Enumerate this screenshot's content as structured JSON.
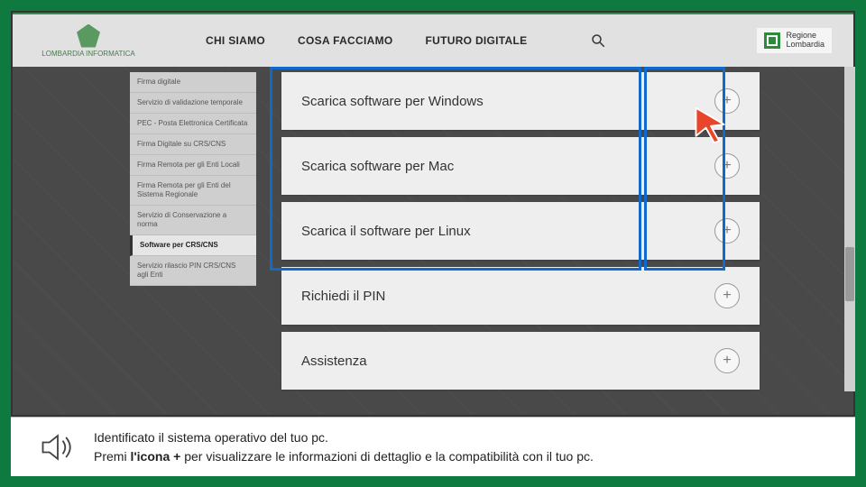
{
  "logo": {
    "label": "LOMBARDIA INFORMATICA"
  },
  "nav": {
    "items": [
      "CHI SIAMO",
      "COSA FACCIAMO",
      "FUTURO DIGITALE"
    ]
  },
  "regione": {
    "line1": "Regione",
    "line2": "Lombardia"
  },
  "sidebar": {
    "items": [
      {
        "label": "Firma digitale",
        "active": false
      },
      {
        "label": "Servizio di validazione temporale",
        "active": false
      },
      {
        "label": "PEC - Posta Elettronica Certificata",
        "active": false
      },
      {
        "label": "Firma Digitale su CRS/CNS",
        "active": false
      },
      {
        "label": "Firma Remota per gli Enti Locali",
        "active": false
      },
      {
        "label": "Firma Remota per gli Enti del Sistema Regionale",
        "active": false
      },
      {
        "label": "Servizio di Conservazione a norma",
        "active": false
      },
      {
        "label": "Software per CRS/CNS",
        "active": true
      },
      {
        "label": "Servizio rilascio PIN CRS/CNS agli Enti",
        "active": false
      }
    ]
  },
  "accordion": {
    "items": [
      {
        "title": "Scarica software per Windows"
      },
      {
        "title": "Scarica software per Mac"
      },
      {
        "title": "Scarica il software per Linux"
      },
      {
        "title": "Richiedi il PIN"
      },
      {
        "title": "Assistenza"
      }
    ]
  },
  "caption": {
    "line1": "Identificato il sistema operativo del tuo pc.",
    "line2_a": "Premi ",
    "line2_b": "l'icona +",
    "line2_c": " per visualizzare le informazioni di dettaglio e la compatibilità con il tuo pc."
  },
  "colors": {
    "frame": "#0f7a3f",
    "highlight": "#1169c9",
    "cursor": "#e8452a"
  }
}
